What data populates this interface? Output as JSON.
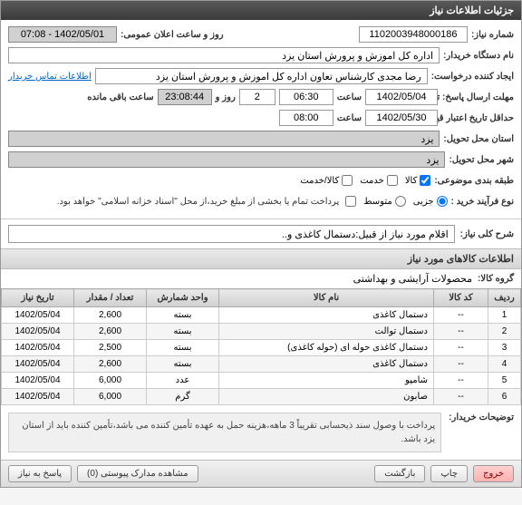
{
  "window": {
    "title": "جزئیات اطلاعات نیاز"
  },
  "form": {
    "need_number_label": "شماره نیاز:",
    "need_number": "1102003948000186",
    "announce_label": "روز و ساعت اعلان عمومی:",
    "announce_value": "1402/05/01 - 07:08",
    "buyer_org_label": "نام دستگاه خریدار:",
    "buyer_org": "اداره کل اموزش و پرورش استان یزد",
    "creator_label": "ایجاد کننده درخواست:",
    "creator": "رضا مجدی کارشناس تعاون اداره کل اموزش و پرورش استان یزد",
    "contact_link": "اطلاعات تماس خریدار",
    "deadline_label": "مهلت ارسال پاسخ: تا تاریخ:",
    "deadline_date": "1402/05/04",
    "time_label": "ساعت",
    "deadline_time": "06:30",
    "days_label": "روز و",
    "days_value": "2",
    "remain_time": "23:08:44",
    "remain_label": "ساعت باقی مانده",
    "validity_label": "حداقل تاریخ اعتبار قیمت: تا تاریخ:",
    "validity_date": "1402/05/30",
    "validity_time": "08:00",
    "province_label": "استان محل تحویل:",
    "province": "یزد",
    "city_label": "شهر محل تحویل:",
    "city": "یزد",
    "category_label": "طبقه بندی موضوعی:",
    "cat_goods": "کالا",
    "cat_service": "خدمت",
    "cat_goods_service": "کالا/خدمت",
    "process_label": "نوع فرآیند خرید :",
    "proc_partial": "جزیی",
    "proc_medium": "متوسط",
    "proc_note": "پرداخت تمام یا بخشی از مبلغ خرید،از محل \"اسناد خزانه اسلامی\" خواهد بود."
  },
  "desc": {
    "label": "شرح کلی نیاز:",
    "value": "اقلام مورد نیاز از قبیل:دستمال کاغذی و.."
  },
  "items_section": {
    "title": "اطلاعات کالاهای مورد نیاز",
    "group_label": "گروه کالا:",
    "group_value": "محصولات آرایشی و بهداشتی"
  },
  "table": {
    "headers": {
      "row": "ردیف",
      "code": "کد کالا",
      "name": "نام کالا",
      "unit": "واحد شمارش",
      "qty": "تعداد / مقدار",
      "date": "تاریخ نیاز"
    },
    "rows": [
      {
        "row": "1",
        "code": "--",
        "name": "دستمال کاغذی",
        "unit": "بسته",
        "qty": "2,600",
        "date": "1402/05/04"
      },
      {
        "row": "2",
        "code": "--",
        "name": "دستمال توالت",
        "unit": "بسته",
        "qty": "2,600",
        "date": "1402/05/04"
      },
      {
        "row": "3",
        "code": "--",
        "name": "دستمال کاغذی حوله ای (حوله کاغذی)",
        "unit": "بسته",
        "qty": "2,500",
        "date": "1402/05/04"
      },
      {
        "row": "4",
        "code": "--",
        "name": "دستمال کاغذی",
        "unit": "بسته",
        "qty": "2,600",
        "date": "1402/05/04"
      },
      {
        "row": "5",
        "code": "--",
        "name": "شامپو",
        "unit": "عدد",
        "qty": "6,000",
        "date": "1402/05/04"
      },
      {
        "row": "6",
        "code": "--",
        "name": "صابون",
        "unit": "گرم",
        "qty": "6,000",
        "date": "1402/05/04"
      }
    ]
  },
  "buyer_desc": {
    "label": "توضیحات خریدار:",
    "text": "پرداخت با وصول سند ذیحسابی تقریباً 3 ماهه،هزینه حمل به عهده تأمین کننده می باشد،تأمین کننده باید از استان یزد باشد."
  },
  "buttons": {
    "exit": "خروج",
    "print": "چاپ",
    "return": "بازگشت",
    "attachments": "مشاهده مدارک پیوستی (0)",
    "reply": "پاسخ به نیاز"
  }
}
